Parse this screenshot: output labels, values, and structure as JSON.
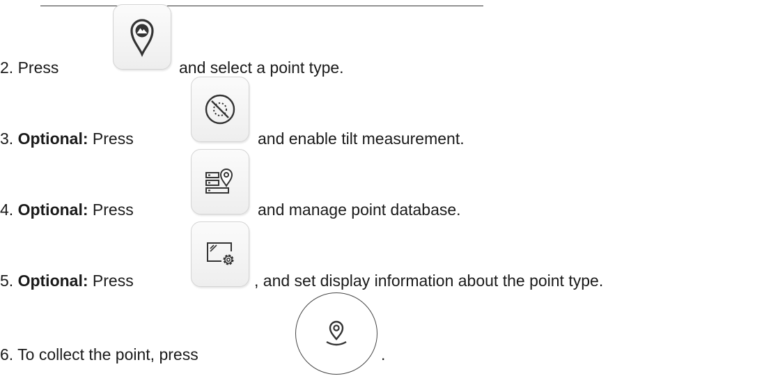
{
  "steps": [
    {
      "number": "2.",
      "prefix": "Press",
      "suffix": "and select a point type.",
      "icon": "map-pin-mountain-icon"
    },
    {
      "number": "3.",
      "optional_label": "Optional:",
      "prefix": "Press",
      "suffix": "and enable tilt measurement.",
      "icon": "tilt-disabled-icon"
    },
    {
      "number": "4.",
      "optional_label": "Optional:",
      "prefix": "Press",
      "suffix": "and manage point database.",
      "icon": "point-database-icon"
    },
    {
      "number": "5.",
      "optional_label": "Optional:",
      "prefix": "Press",
      "suffix": ", and set display information about the point type.",
      "icon": "display-settings-icon"
    },
    {
      "number": "6.",
      "prefix": "To collect the point, press",
      "suffix": ".",
      "icon": "collect-point-icon"
    }
  ]
}
